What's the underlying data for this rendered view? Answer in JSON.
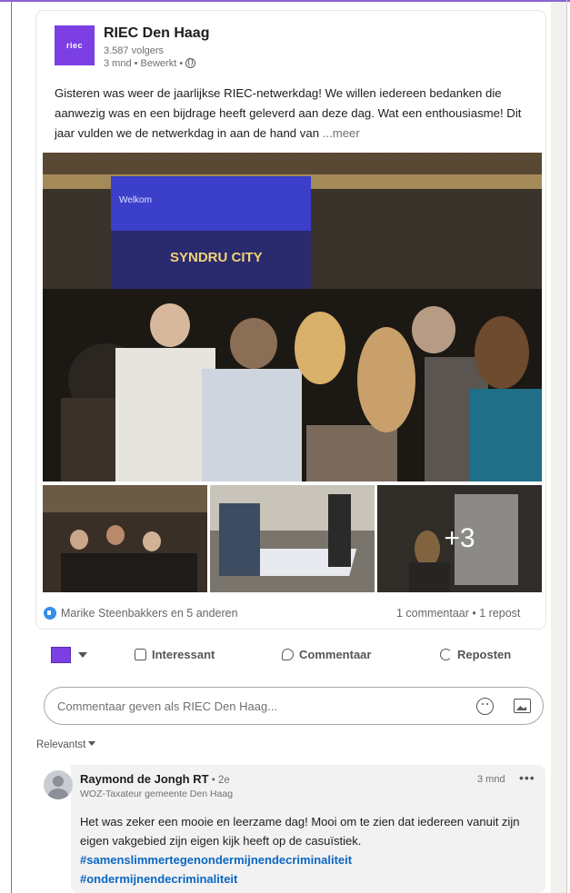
{
  "post": {
    "org_name": "RIEC Den Haag",
    "logo_text": "riec",
    "followers": "3.587 volgers",
    "meta": "3 mnd • Bewerkt •",
    "text": "Gisteren was weer de jaarlijkse RIEC-netwerkdag! We willen iedereen bedanken die aanwezig was en een bijdrage heeft geleverd aan deze dag. Wat een enthousiasme! Dit jaar vulden we de netwerkdag in aan de hand van",
    "more": "...meer"
  },
  "media": {
    "slide_title": "Welkom",
    "slide_brand": "SYNDRU CITY",
    "more_count": "+3"
  },
  "social": {
    "reactions": "Marike Steenbakkers en 5 anderen",
    "stats": "1 commentaar • 1 repost"
  },
  "actions": {
    "interesting": "Interessant",
    "comment": "Commentaar",
    "repost": "Reposten"
  },
  "comment_input": {
    "placeholder": "Commentaar geven als RIEC Den Haag..."
  },
  "sort": {
    "label": "Relevantst"
  },
  "comment": {
    "author": "Raymond de Jongh RT",
    "degree": " • 2e",
    "subtitle": "WOZ-Taxateur gemeente Den Haag",
    "time": "3 mnd",
    "dots": "•••",
    "text": "Het was zeker een mooie en leerzame dag! Mooi om te zien dat iedereen vanuit zijn eigen vakgebied zijn eigen kijk heeft op de casuïstiek.",
    "tag1": "#samenslimmertegenondermijnendecriminaliteit",
    "tag2": "#ondermijnendecriminaliteit"
  },
  "colors": {
    "brand": "#7b3fe4",
    "link": "#0a66c2",
    "like": "#378fe9"
  }
}
